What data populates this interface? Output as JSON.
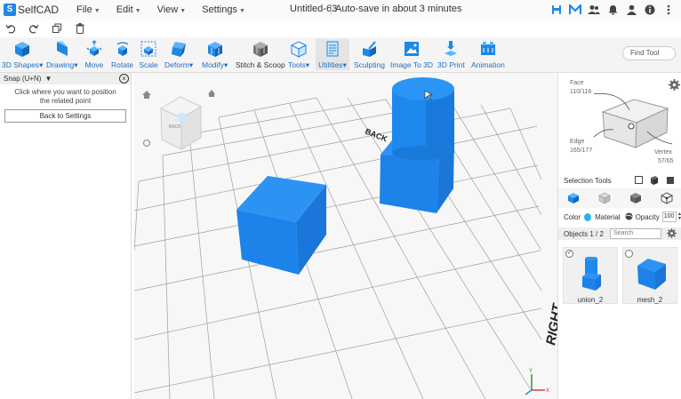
{
  "app": {
    "logo_letter": "S",
    "logo_text": "SelfCAD"
  },
  "menu": [
    {
      "label": "File"
    },
    {
      "label": "Edit"
    },
    {
      "label": "View"
    },
    {
      "label": "Settings"
    }
  ],
  "document": {
    "title": "Untitled-63",
    "autosave": "Auto-save in about 3 minutes"
  },
  "top_icons": [
    "save-icon",
    "m-brand-icon",
    "users-icon",
    "bell-icon",
    "user-icon",
    "info-icon",
    "more-icon"
  ],
  "toolbar": {
    "tools": [
      {
        "label": "3D Shapes",
        "caret": "▾",
        "icon": "cube-icon"
      },
      {
        "label": "Drawing",
        "caret": "▾",
        "icon": "pencil-icon"
      },
      {
        "label": "Move",
        "caret": "",
        "icon": "move-icon"
      },
      {
        "label": "Rotate",
        "caret": "",
        "icon": "rotate-icon"
      },
      {
        "label": "Scale",
        "caret": "",
        "icon": "scale-icon"
      },
      {
        "label": "Deform",
        "caret": "▾",
        "icon": "deform-icon"
      },
      {
        "label": "Modify",
        "caret": "▾",
        "icon": "modify-icon"
      },
      {
        "label": "Stitch & Scoop",
        "caret": "",
        "icon": "stitch-icon"
      },
      {
        "label": "Tools",
        "caret": "▾",
        "icon": "tools-icon"
      },
      {
        "label": "Utilities",
        "caret": "▾",
        "icon": "utilities-icon"
      },
      {
        "label": "Sculpting",
        "caret": "",
        "icon": "sculpting-icon"
      },
      {
        "label": "Image To 3D",
        "caret": "",
        "icon": "image-to-3d-icon"
      },
      {
        "label": "3D Print",
        "caret": "",
        "icon": "3d-print-icon"
      },
      {
        "label": "Animation",
        "caret": "",
        "icon": "animation-icon"
      }
    ],
    "find_placeholder": "Find Tool"
  },
  "snap_panel": {
    "title": "Snap (U+N)",
    "caret": "▼",
    "message": "Click where you want to position the related point",
    "back_button": "Back to Settings"
  },
  "viewport": {
    "back_label": "BACK",
    "right_label": "RIGHT",
    "viewcube_label": "BACK"
  },
  "right_panel": {
    "face_label": "Face",
    "face_count": "110/116",
    "edge_label": "Edge",
    "edge_count": "165/177",
    "vertex_label": "Vertex",
    "vertex_count": "57/65",
    "selection_tools": "Selection Tools",
    "color_label": "Color",
    "material_label": "Material",
    "opacity_label": "Opacity",
    "opacity_value": "100",
    "objects_label": "Objects 1 / 2",
    "search_placeholder": "Search",
    "objects": [
      {
        "name": "union_2",
        "checked": true
      },
      {
        "name": "mesh_2",
        "checked": false
      }
    ]
  },
  "colors": {
    "accent": "#1e88e5",
    "object": "#1d8ff0",
    "label_blue": "#1e6fc8"
  }
}
